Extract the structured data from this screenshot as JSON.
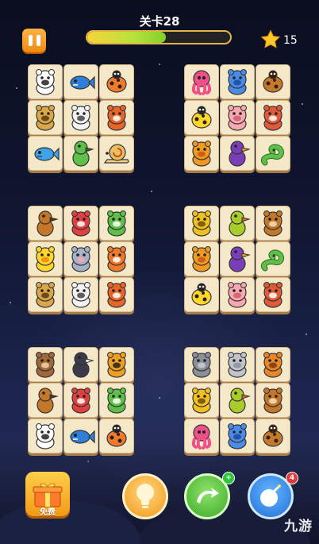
{
  "header": {
    "level_title": "关卡28",
    "progress": 0.55,
    "stars": "15",
    "pause_icon": "pause-icon",
    "star_icon": "star-icon"
  },
  "board": {
    "groups": [
      {
        "tiles": [
          "polar-bear",
          "shark",
          "ladybug",
          "owl",
          "seal",
          "squirrel",
          "fish",
          "dinosaur",
          "snail"
        ]
      },
      {
        "tiles": [
          "octopus",
          "rhino",
          "ant",
          "bee",
          "pig",
          "hedgehog",
          "lion",
          "toucan",
          "snake"
        ]
      },
      {
        "tiles": [
          "horse",
          "gorilla",
          "frog",
          "duck",
          "mouse",
          "fox",
          "owl",
          "seal",
          "squirrel"
        ]
      },
      {
        "tiles": [
          "leopard",
          "parrot",
          "bull",
          "lion",
          "toucan",
          "snake",
          "bee",
          "pig",
          "hedgehog"
        ]
      },
      {
        "tiles": [
          "bear",
          "penguin",
          "tiger",
          "horse",
          "gorilla",
          "frog",
          "polar-bear",
          "shark",
          "ladybug"
        ]
      },
      {
        "tiles": [
          "hippo",
          "elephant",
          "dog",
          "leopard",
          "parrot",
          "bull",
          "octopus",
          "rhino",
          "ant"
        ]
      }
    ]
  },
  "bottom": {
    "free_label": "免费",
    "watermark": "九游"
  },
  "colors": {
    "tile_bg": "#f5e8c8",
    "progress_start": "#f7d43a",
    "progress_end": "#7fd02a",
    "pause": "#f08a12"
  }
}
